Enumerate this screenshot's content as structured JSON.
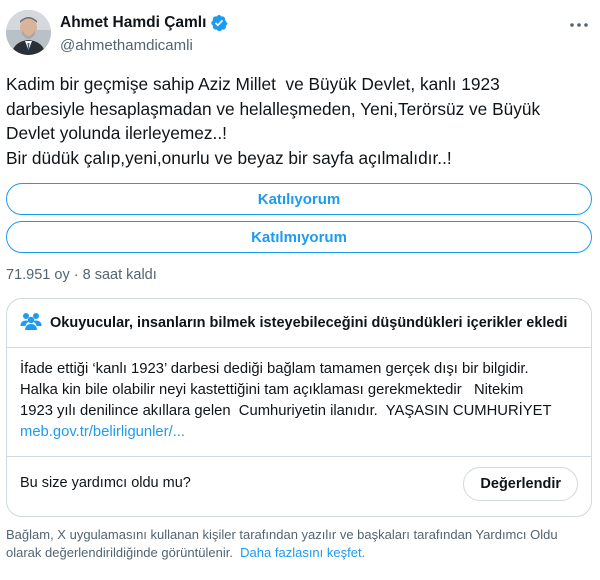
{
  "author": {
    "name": "Ahmet Hamdi Çamlı",
    "handle": "@ahmethamdicamli"
  },
  "tweet": {
    "lines": [
      "Kadim bir geçmişe sahip Aziz Millet  ve Büyük Devlet, kanlı 1923",
      "darbesiyle hesaplaşmadan ve helalleşmeden, Yeni,Terörsüz ve Büyük",
      "Devlet yolunda ilerleyemez..!",
      "Bir düdük çalıp,yeni,onurlu ve beyaz bir sayfa açılmalıdır..!"
    ]
  },
  "poll": {
    "option1": "Katılıyorum",
    "option2": "Katılmıyorum",
    "votes": "71.951 oy",
    "separator": "·",
    "time_left": "8 saat kaldı"
  },
  "community_note": {
    "title": "Okuyucular, insanların bilmek isteyebileceğini düşündükleri içerikler ekledi",
    "lines": [
      "İfade ettiği ‘kanlı 1923’ darbesi dediği bağlam tamamen gerçek dışı bir bilgidir.",
      "Halka kin bile olabilir neyi kastettiğini tam açıklaması gerekmektedir   Nitekim",
      "1923 yılı denilince akıllara gelen  Cumhuriyetin ilanıdır.  YAŞASIN CUMHURİYET"
    ],
    "link": "meb.gov.tr/belirligunler/...",
    "helpful_question": "Bu size yardımcı oldu mu?",
    "rate_button": "Değerlendir"
  },
  "footer": {
    "line1": "Bağlam, X uygulamasını kullanan kişiler tarafından yazılır ve başkaları tarafından Yardımcı Oldu",
    "line2": "olarak değerlendirildiğinde görüntülenir.",
    "link": "Daha fazlasını keşfet."
  },
  "colors": {
    "accent": "#1d9bf0",
    "text": "#0f1419",
    "muted": "#536471",
    "border": "#cfd9de"
  },
  "icons": {
    "verified": "verified-badge-icon",
    "more": "more-options-icon",
    "people": "people-icon"
  }
}
